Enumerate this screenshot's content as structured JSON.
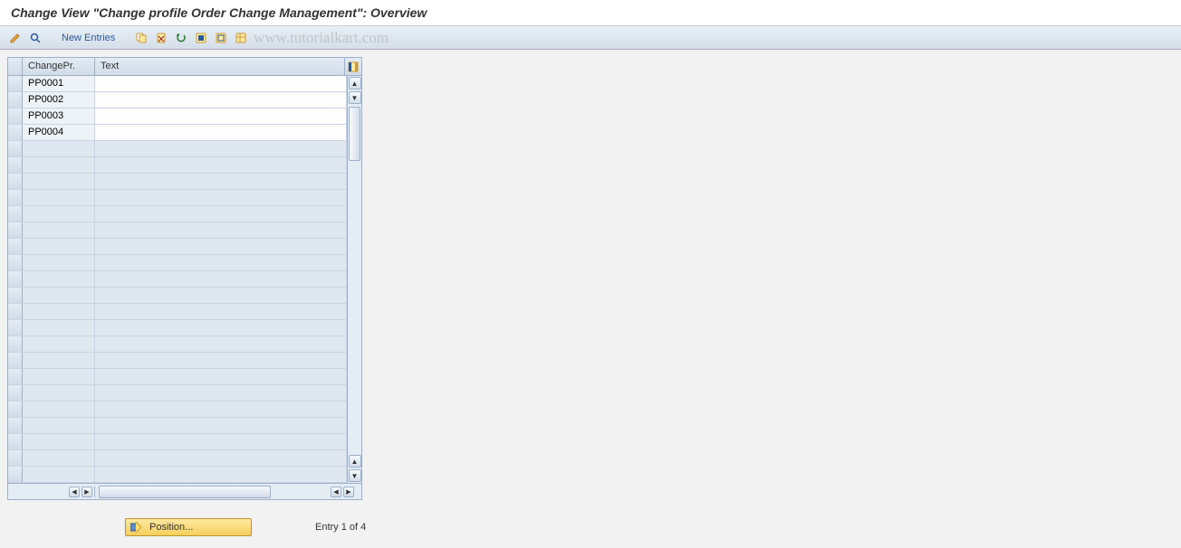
{
  "title": "Change View \"Change profile Order Change Management\": Overview",
  "toolbar": {
    "new_entries_label": "New Entries"
  },
  "watermark": "www.tutorialkart.com",
  "table": {
    "columns": {
      "change_pr": "ChangePr.",
      "text": "Text"
    },
    "rows": [
      {
        "change_pr": "PP0001",
        "text": ""
      },
      {
        "change_pr": "PP0002",
        "text": ""
      },
      {
        "change_pr": "PP0003",
        "text": ""
      },
      {
        "change_pr": "PP0004",
        "text": ""
      }
    ],
    "empty_rows": 21
  },
  "footer": {
    "position_label": "Position...",
    "entry_text": "Entry 1 of 4"
  }
}
